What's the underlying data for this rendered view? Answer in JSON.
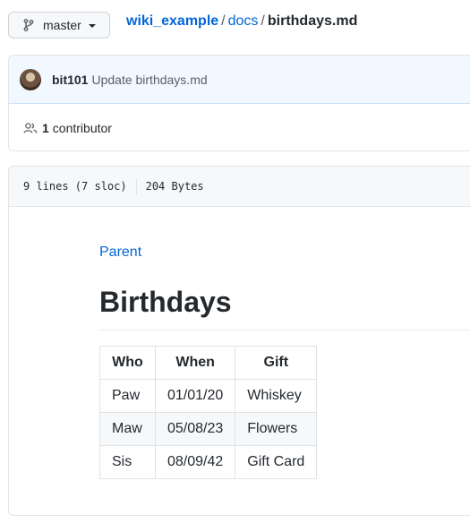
{
  "branch": {
    "label": "master",
    "icon": "git-branch-icon"
  },
  "breadcrumb": {
    "repo": "wiki_example",
    "sep1": "/",
    "dir": "docs",
    "sep2": "/",
    "file": "birthdays.md"
  },
  "commit": {
    "author": "bit101",
    "message": "Update birthdays.md"
  },
  "contributors": {
    "count": "1",
    "label": "contributor",
    "icon": "people-icon"
  },
  "file_info": {
    "lines": "9 lines (7 sloc)",
    "size": "204 Bytes"
  },
  "content": {
    "parent_link": "Parent",
    "title": "Birthdays",
    "table": {
      "headers": [
        "Who",
        "When",
        "Gift"
      ],
      "rows": [
        [
          "Paw",
          "01/01/20",
          "Whiskey"
        ],
        [
          "Maw",
          "05/08/23",
          "Flowers"
        ],
        [
          "Sis",
          "08/09/42",
          "Gift Card"
        ]
      ]
    }
  },
  "colors": {
    "link": "#0366d6",
    "commit_bg": "#f1f8ff",
    "text": "#24292e",
    "muted": "#586069"
  }
}
